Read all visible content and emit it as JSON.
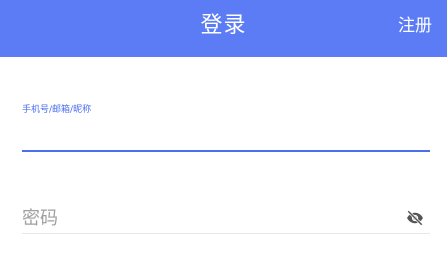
{
  "header": {
    "title": "登录",
    "register_label": "注册",
    "background_color": "#5b7cf5"
  },
  "form": {
    "username": {
      "label": "手机号/邮箱/昵称",
      "value": "",
      "accent_color": "#4a6ef0"
    },
    "password": {
      "placeholder": "密码",
      "value": "",
      "toggle_icon": "eye-off-icon"
    }
  }
}
